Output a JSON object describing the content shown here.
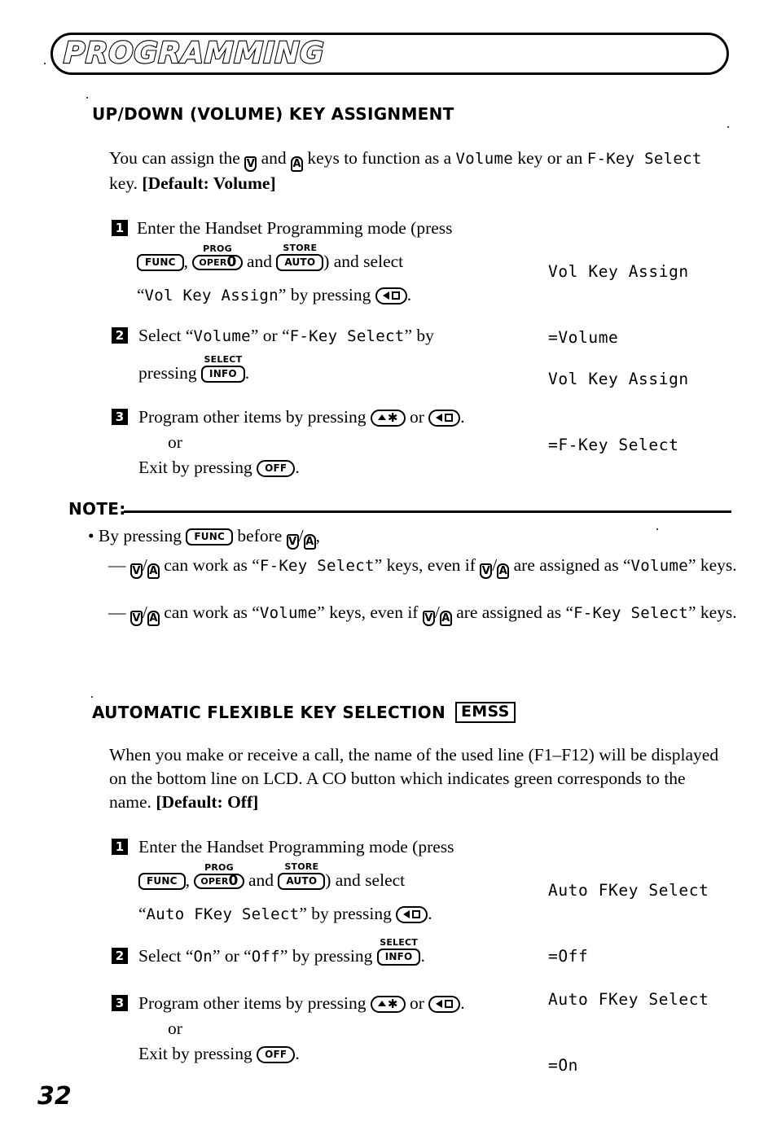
{
  "page": {
    "banner_title": "PROGRAMMING",
    "page_number": "32"
  },
  "sections": [
    {
      "heading": "UP/DOWN (VOLUME) KEY ASSIGNMENT",
      "intro_part1": "You can assign the ",
      "intro_and": " and ",
      "intro_part2": " keys to function as a ",
      "intro_volume": "Volume",
      "intro_part3": " key or an ",
      "intro_fkey": "F-Key Select",
      "intro_part4": " key. ",
      "intro_default": "[Default: Volume]",
      "steps": [
        {
          "number": "1",
          "line1": "Enter the Handset Programming mode (press",
          "line2_mid": " and ",
          "line2_end": ") and select",
          "line3_pre": "“",
          "line3_mono": "Vol Key Assign",
          "line3_post": "” by pressing",
          "line3_tail": ".",
          "lcd_line1": "Vol Key Assign",
          "lcd_line2": "=Volume"
        },
        {
          "number": "2",
          "line1_pre": "Select “",
          "line1_mono1": "Volume",
          "line1_mid": "” or “",
          "line1_mono2": "F-Key Select",
          "line1_post": "” by",
          "line2_pre": "pressing",
          "line2_post": ".",
          "lcd_line1": "Vol Key Assign",
          "lcd_line2": "=F-Key Select"
        },
        {
          "number": "3",
          "line1_pre": "Program other items by pressing",
          "line1_mid": " or ",
          "line1_post": ".",
          "line2": "or",
          "line3_pre": "Exit by pressing",
          "line3_post": "."
        }
      ]
    },
    {
      "heading": "AUTOMATIC FLEXIBLE KEY SELECTION",
      "badge": "EMSS",
      "intro": "When you make or receive a call, the name of the used line (F1–F12) will be displayed on the bottom line on LCD. A CO button which indicates green corresponds to the name. ",
      "intro_default": "[Default: Off]",
      "steps": [
        {
          "number": "1",
          "line1": "Enter the Handset Programming mode (press",
          "line2_mid": " and ",
          "line2_end": ") and select",
          "line3_pre": "“",
          "line3_mono": "Auto FKey Select",
          "line3_post": "” by pressing",
          "line3_tail": ".",
          "lcd_line1": "Auto FKey Select",
          "lcd_line2": "=Off"
        },
        {
          "number": "2",
          "line1_pre": "Select “",
          "line1_mono1": "On",
          "line1_mid": "” or “",
          "line1_mono2": "Off",
          "line1_post": "” by pressing",
          "line1_tail": ".",
          "lcd_line1": "Auto FKey Select",
          "lcd_line2": "=On"
        },
        {
          "number": "3",
          "line1_pre": "Program other items by pressing",
          "line1_mid": " or ",
          "line1_post": ".",
          "line2": "or",
          "line3_pre": "Exit by pressing",
          "line3_post": "."
        }
      ]
    }
  ],
  "note": {
    "label": "NOTE:",
    "bullet_pre": "By pressing",
    "bullet_mid": " before ",
    "bullet_post": ",",
    "items": [
      {
        "dash": "—",
        "pre": " can work as “",
        "mono1": "F-Key Select",
        "mid": "” keys, even if ",
        "post": " are assigned as “",
        "mono2": "Volume",
        "tail": "” keys."
      },
      {
        "dash": "—",
        "pre": " can work as “",
        "mono1": "Volume",
        "mid": "” keys, even if ",
        "post": " are assigned as “",
        "mono2": "F-Key Select",
        "tail": "” keys."
      }
    ]
  },
  "keys": {
    "func": "FUNC",
    "prog_sup": "PROG",
    "oper": "OPER",
    "oper_zero": "0",
    "store_sup": "STORE",
    "auto": "AUTO",
    "select_sup": "SELECT",
    "info": "INFO",
    "off": "OFF",
    "star": "✱",
    "up_glyph": "△",
    "down_glyph": "▽"
  },
  "colors": {
    "ink": "#000000",
    "paper": "#ffffff"
  }
}
